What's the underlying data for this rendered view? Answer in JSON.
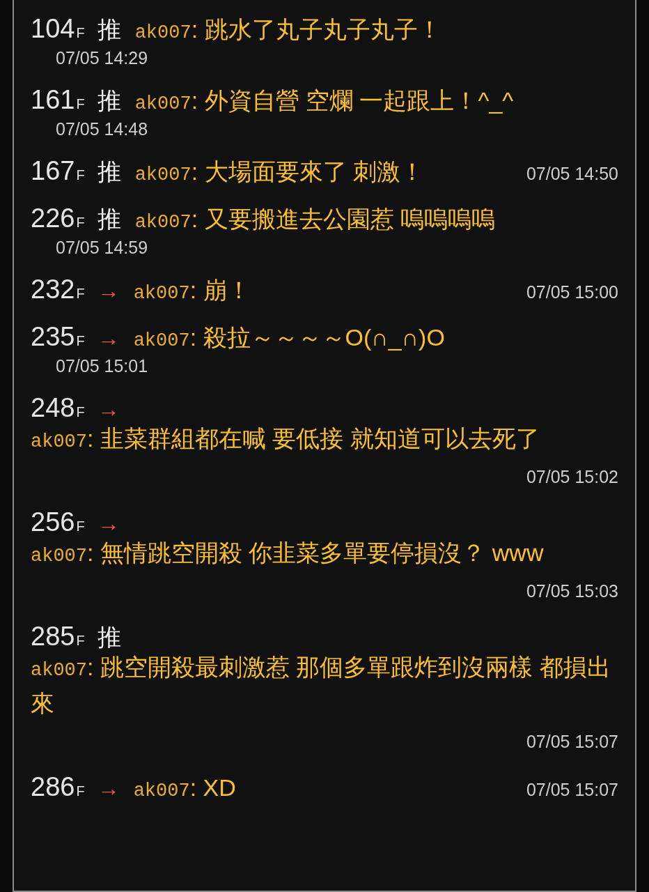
{
  "comments": [
    {
      "kind": "double",
      "floor": "104",
      "floor_suffix": "F",
      "tag": {
        "kind": "push",
        "label": "推"
      },
      "user": "ak007",
      "content": ": 跳水了丸子丸子丸子！",
      "time": "07/05 14:29"
    },
    {
      "kind": "double",
      "floor": "161",
      "floor_suffix": "F",
      "tag": {
        "kind": "push",
        "label": "推"
      },
      "user": "ak007",
      "content": ": 外資自營 空爛 一起跟上！^_^",
      "time": "07/05 14:48"
    },
    {
      "kind": "single",
      "floor": "167",
      "floor_suffix": "F",
      "tag": {
        "kind": "push",
        "label": "推"
      },
      "user": "ak007",
      "content": ": 大場面要來了 刺激！",
      "time": "07/05 14:50"
    },
    {
      "kind": "double",
      "floor": "226",
      "floor_suffix": "F",
      "tag": {
        "kind": "push",
        "label": "推"
      },
      "user": "ak007",
      "content": ": 又要搬進去公園惹 嗚嗚嗚嗚",
      "time": "07/05 14:59"
    },
    {
      "kind": "single",
      "floor": "232",
      "floor_suffix": "F",
      "tag": {
        "kind": "arrow",
        "label": "→"
      },
      "user": "ak007",
      "content": ": 崩！",
      "time": "07/05 15:00"
    },
    {
      "kind": "double",
      "floor": "235",
      "floor_suffix": "F",
      "tag": {
        "kind": "arrow",
        "label": "→"
      },
      "user": "ak007",
      "content": ": 殺拉～～～～O(∩_∩)O",
      "time": "07/05 15:01"
    },
    {
      "kind": "wrapped",
      "floor": "248",
      "floor_suffix": "F",
      "tag": {
        "kind": "arrow",
        "label": "→"
      },
      "user": "ak007",
      "content": ": 韭菜群組都在喊 要低接 就知道可以去死了",
      "time": "07/05 15:02"
    },
    {
      "kind": "wrapped",
      "floor": "256",
      "floor_suffix": "F",
      "tag": {
        "kind": "arrow",
        "label": "→"
      },
      "user": "ak007",
      "content": ": 無情跳空開殺 你韭菜多單要停損沒？ www",
      "time": "07/05 15:03"
    },
    {
      "kind": "wrapped",
      "floor": "285",
      "floor_suffix": "F",
      "tag": {
        "kind": "push",
        "label": "推"
      },
      "user": "ak007",
      "content": ": 跳空開殺最刺激惹 那個多單跟炸到沒兩樣 都損出來",
      "time": "07/05 15:07"
    },
    {
      "kind": "single",
      "floor": "286",
      "floor_suffix": "F",
      "tag": {
        "kind": "arrow",
        "label": "→"
      },
      "user": "ak007",
      "content": ": XD",
      "time": "07/05 15:07"
    }
  ]
}
